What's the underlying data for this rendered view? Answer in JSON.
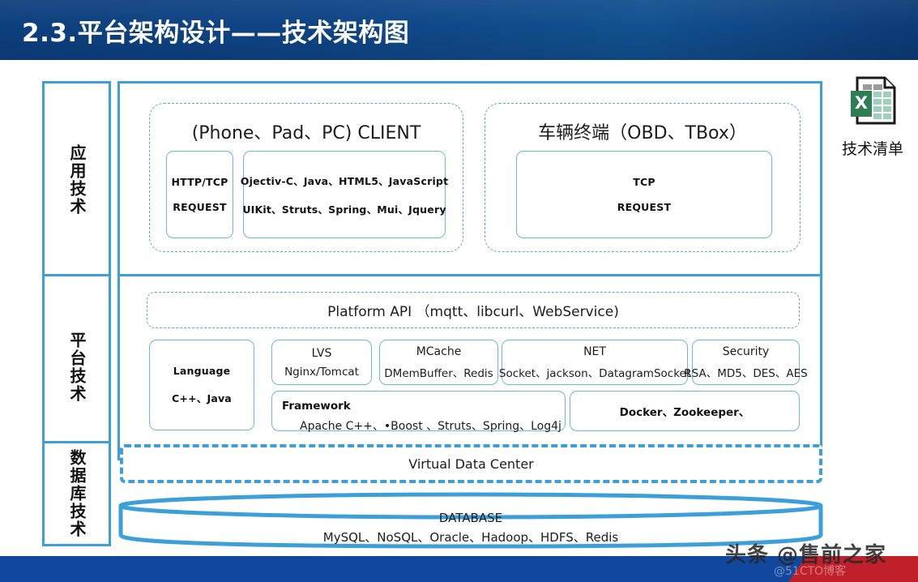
{
  "header": {
    "title": "2.3.平台架构设计——技术架构图",
    "bg_color": "#0e4485"
  },
  "theme": {
    "accent": "#3c9fd8",
    "light_border": "#6eb7e0",
    "dashed": "#59a8dd",
    "bottom_blue": "#11479c",
    "bottom_red": "#c0202a"
  },
  "sidebar": {
    "items": [
      {
        "label": "应用技术"
      },
      {
        "label": "平台技术"
      },
      {
        "label": "数据库技术"
      }
    ]
  },
  "app_layer": {
    "groups": [
      {
        "title": "(Phone、Pad、PC) CLIENT",
        "boxes": [
          {
            "lines": [
              "HTTP/TCP",
              "REQUEST"
            ]
          },
          {
            "lines": [
              "Ojectiv-C、Java、HTML5、JavaScript",
              "UIKit、Struts、Spring、Mui、Jquery"
            ]
          }
        ]
      },
      {
        "title": "车辆终端（OBD、TBox）",
        "boxes": [
          {
            "lines": [
              "TCP",
              "REQUEST"
            ]
          }
        ]
      }
    ]
  },
  "platform_layer": {
    "api_box": "Platform API （mqtt、libcurl、WebService)",
    "language_box": {
      "title": "Language",
      "sub": "C++、Java"
    },
    "modules": [
      {
        "title": "LVS",
        "sub": "Nginx/Tomcat"
      },
      {
        "title": "MCache",
        "sub": "DMemBuffer、Redis"
      },
      {
        "title": "NET",
        "sub": "Socket、jackson、DatagramSocket"
      },
      {
        "title": "Security",
        "sub": "RSA、MD5、DES、AES"
      }
    ],
    "framework_box": {
      "head": "Framework",
      "body": "Apache C++、•Boost 、Struts、Spring、Log4j"
    },
    "container_box": "Docker、Zookeeper、"
  },
  "database_layer": {
    "virtual_data_center": "Virtual Data Center",
    "database": {
      "title": "DATABASE",
      "items": "MySQL、NoSQL、Oracle、Hadoop、HDFS、Redis"
    }
  },
  "attachment": {
    "icon": "excel-file-icon",
    "label": "技术清单"
  },
  "watermarks": {
    "primary": "头条 @售前之家",
    "secondary": "@51CTO博客"
  }
}
